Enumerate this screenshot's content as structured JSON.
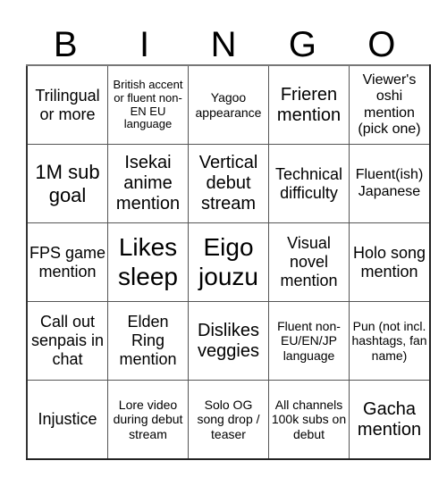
{
  "header": {
    "letters": [
      "B",
      "I",
      "N",
      "G",
      "O"
    ]
  },
  "board": {
    "rows": [
      [
        "Trilingual or more",
        "British accent or fluent non-EN EU language",
        "Yagoo appearance",
        "Frieren mention",
        "Viewer's oshi mention (pick one)"
      ],
      [
        "1M sub goal",
        "Isekai anime mention",
        "Vertical debut stream",
        "Technical difficulty",
        "Fluent(ish) Japanese"
      ],
      [
        "FPS game mention",
        "Likes sleep",
        "Eigo jouzu",
        "Visual novel mention",
        "Holo song mention"
      ],
      [
        "Call out senpais in chat",
        "Elden Ring mention",
        "Dislikes veggies",
        "Fluent non-EU/EN/JP language",
        "Pun (not incl. hashtags, fan name)"
      ],
      [
        "Injustice",
        "Lore video during debut stream",
        "Solo OG song drop / teaser",
        "All channels 100k subs on debut",
        "Gacha mention"
      ]
    ]
  }
}
